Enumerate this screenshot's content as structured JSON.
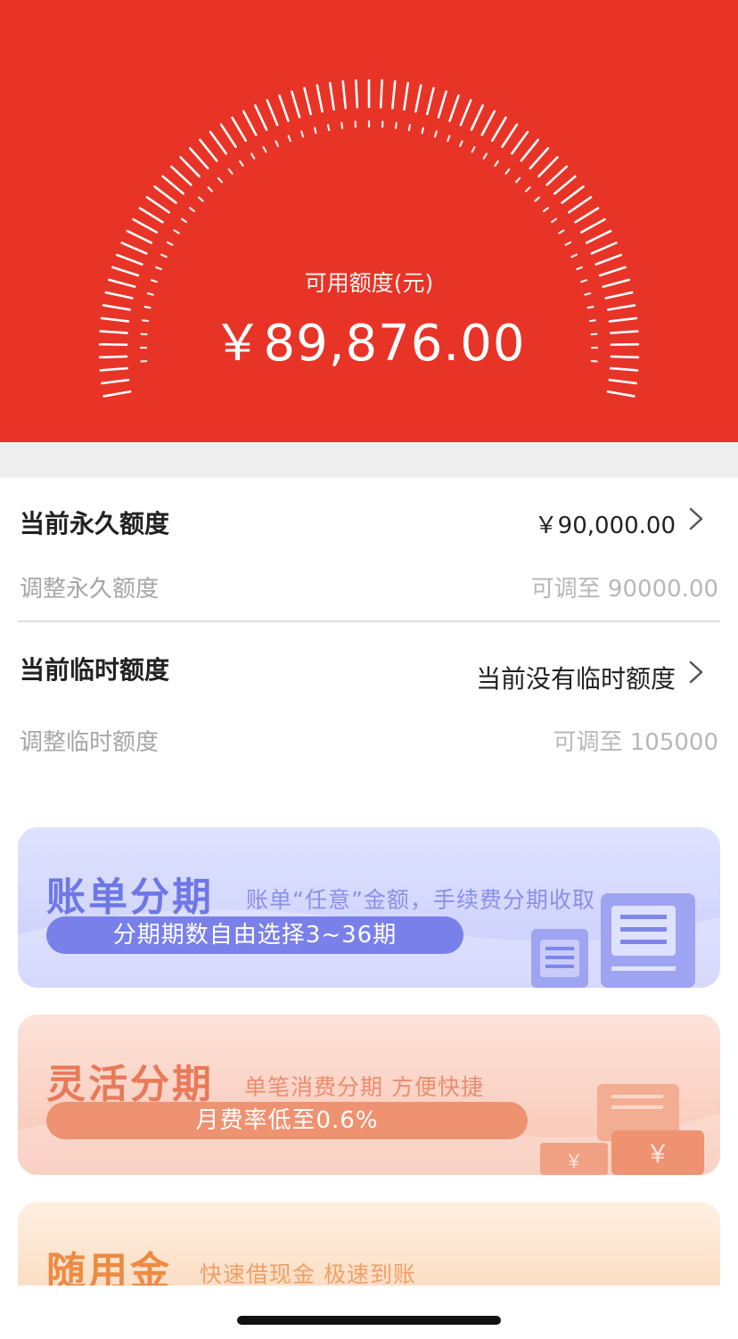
{
  "header": {
    "available_label": "可用额度(元)",
    "available_amount": "￥89,876.00"
  },
  "permanent": {
    "title": "当前永久额度",
    "value": "￥90,000.00",
    "adjust_label": "调整永久额度",
    "adjust_value": "可调至 90000.00"
  },
  "temporary": {
    "title": "当前临时额度",
    "value": "当前没有临时额度",
    "adjust_label": "调整临时额度",
    "adjust_value": "可调至 105000"
  },
  "cards": [
    {
      "title": "账单分期",
      "subtitle": "账单“任意”金额，手续费分期收取",
      "pill": "分期期数自由选择3~36期"
    },
    {
      "title": "灵活分期",
      "subtitle": "单笔消费分期 方便快捷",
      "pill": "月费率低至0.6%"
    },
    {
      "title": "随用金",
      "subtitle": "快速借现金 极速到账"
    }
  ],
  "icons": [
    "chevron-right-icon",
    "document-icon",
    "yen-box-icon"
  ],
  "colors": {
    "header_bg": "#e73427",
    "card1_accent": "#6e77e6",
    "card2_accent": "#e9795a",
    "card3_accent": "#ee8a43"
  }
}
